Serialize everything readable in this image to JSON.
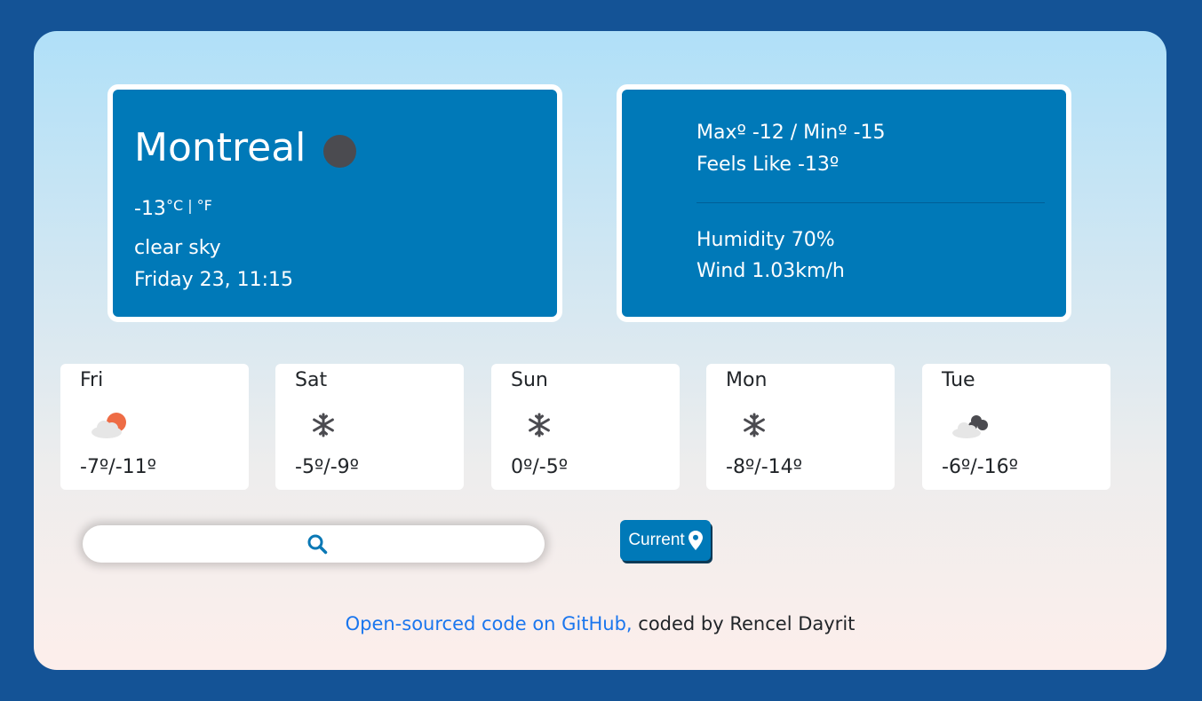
{
  "current": {
    "city": "Montreal",
    "temperature": "-13",
    "unit_celsius": "°C",
    "unit_separator": " | ",
    "unit_fahrenheit": "°F",
    "description": "clear sky",
    "datetime": "Friday 23, 11:15",
    "icon": "moon-icon"
  },
  "details": {
    "max_min": "Maxº -12 / Minº -15",
    "feels_like": "Feels Like -13º",
    "humidity": "Humidity 70%",
    "wind": "Wind 1.03km/h"
  },
  "forecast": [
    {
      "day": "Fri",
      "temp": "-7º/-11º",
      "icon": "partly-cloudy-sun-icon"
    },
    {
      "day": "Sat",
      "temp": "-5º/-9º",
      "icon": "snowflake-icon"
    },
    {
      "day": "Sun",
      "temp": "0º/-5º",
      "icon": "snowflake-icon"
    },
    {
      "day": "Mon",
      "temp": "-8º/-14º",
      "icon": "snowflake-icon"
    },
    {
      "day": "Tue",
      "temp": "-6º/-16º",
      "icon": "broken-clouds-icon"
    }
  ],
  "search": {
    "placeholder": "",
    "icon": "search-icon"
  },
  "current_button": {
    "label": "Current",
    "icon": "location-pin-icon"
  },
  "footer": {
    "link_text": "Open-sourced code on GitHub,",
    "credit_text": " coded by Rencel Dayrit"
  },
  "colors": {
    "page_background": "#145396",
    "card_blue": "#0079b8",
    "link_blue": "#1a76ee",
    "snow_icon": "#4b4b50",
    "sun_orange": "#ee6c45"
  }
}
